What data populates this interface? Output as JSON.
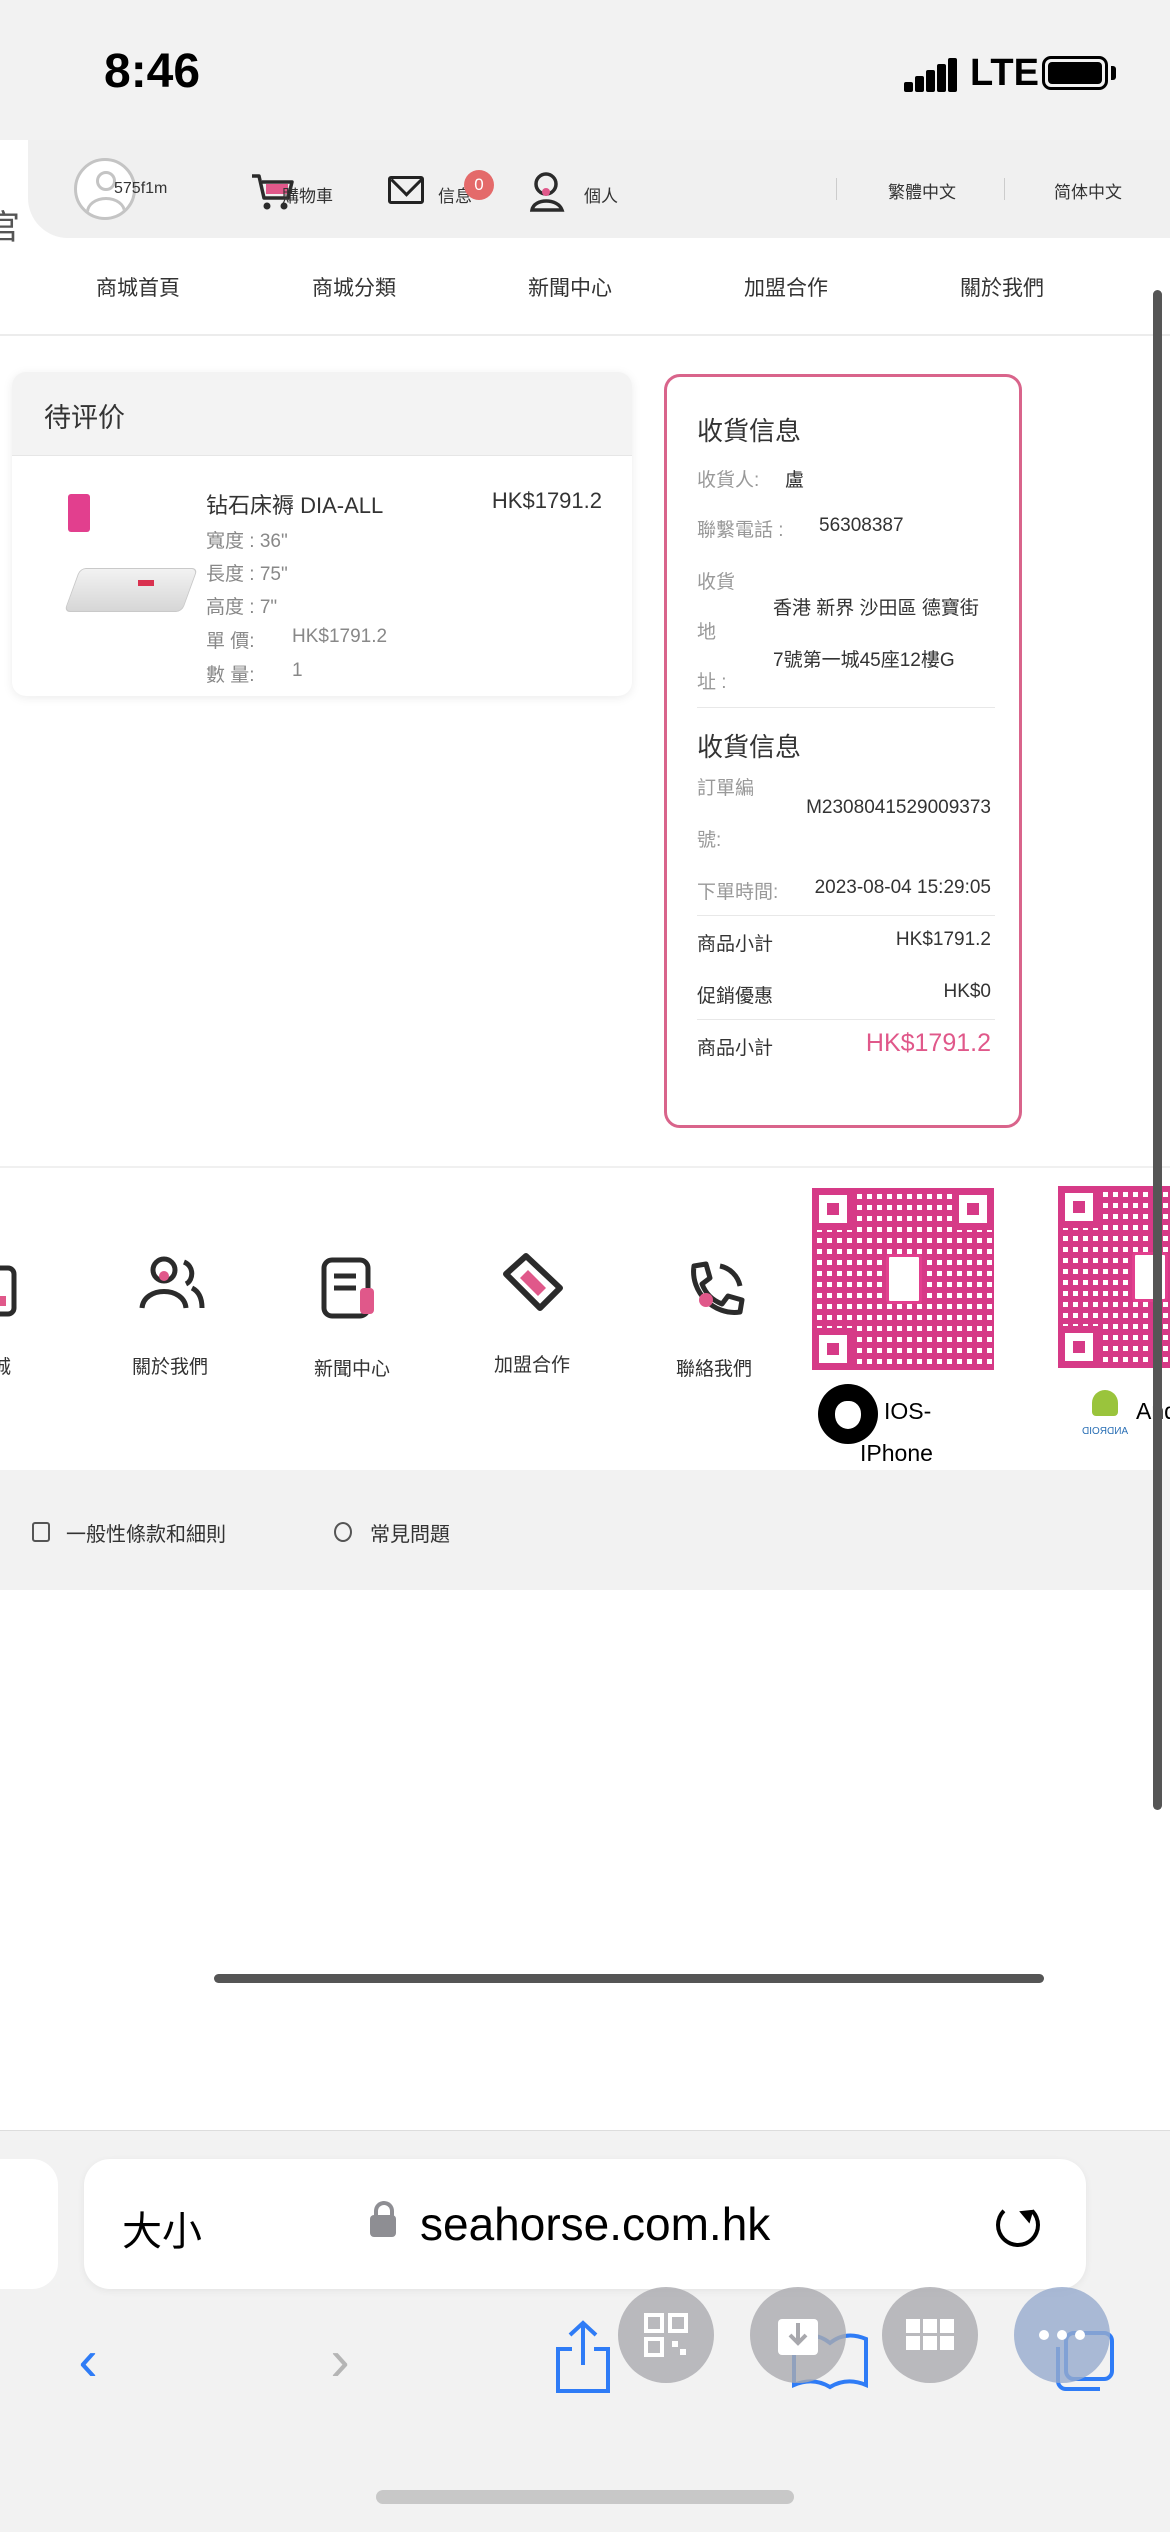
{
  "status": {
    "time": "8:46",
    "network": "LTE"
  },
  "header": {
    "left_edge_char": "官",
    "username": "575f1m",
    "cart_label": "購物車",
    "messages_label": "信息",
    "messages_count": "0",
    "profile_label": "個人",
    "lang_traditional": "繁體中文",
    "lang_simplified": "简体中文"
  },
  "nav": {
    "items": [
      "商城首頁",
      "商城分類",
      "新聞中心",
      "加盟合作",
      "關於我們"
    ]
  },
  "order": {
    "status_title": "待评价",
    "product_name": "钻石床褥 DIA-ALL",
    "product_price": "HK$1791.2",
    "width": "寬度 : 36\"",
    "length": "長度 : 75\"",
    "height": "高度 : 7\"",
    "unit_price_label": "單 價:",
    "unit_price": "HK$1791.2",
    "qty_label": "數 量:",
    "qty": "1"
  },
  "shipping": {
    "title1": "收貨信息",
    "recipient_label": "收貨人:",
    "recipient": "盧",
    "phone_label": "聯繫電話 :",
    "phone": "56308387",
    "address_label_1": "收貨",
    "address_label_2": "地",
    "address_label_3": "址 :",
    "address_line1": "香港 新界 沙田區 德寶街",
    "address_line2": "7號第一城45座12樓G",
    "title2": "收貨信息",
    "order_no_label_1": "訂單編",
    "order_no_label_2": "號:",
    "order_no": "M2308041529009373",
    "time_label": "下單時間:",
    "time": "2023-08-04 15:29:05",
    "subtotal_label": "商品小計",
    "subtotal": "HK$1791.2",
    "promo_label": "促銷優惠",
    "promo": "HK$0",
    "total_label": "商品小計",
    "total": "HK$1791.2"
  },
  "footer": {
    "partial_label": "城",
    "about": "關於我們",
    "news": "新聞中心",
    "join": "加盟合作",
    "contact": "聯絡我們",
    "ios_label": "IOS-",
    "ios_label2": "IPhone",
    "android_label": "And",
    "android_logo_text": "ANDROID",
    "terms": "一般性條款和細則",
    "faq": "常見問題"
  },
  "browser": {
    "text_size": "大小",
    "url": "seahorse.com.hk"
  },
  "colors": {
    "accent": "#e0588a",
    "badge": "#e46a6a",
    "ios_blue": "#2f7cf6"
  }
}
